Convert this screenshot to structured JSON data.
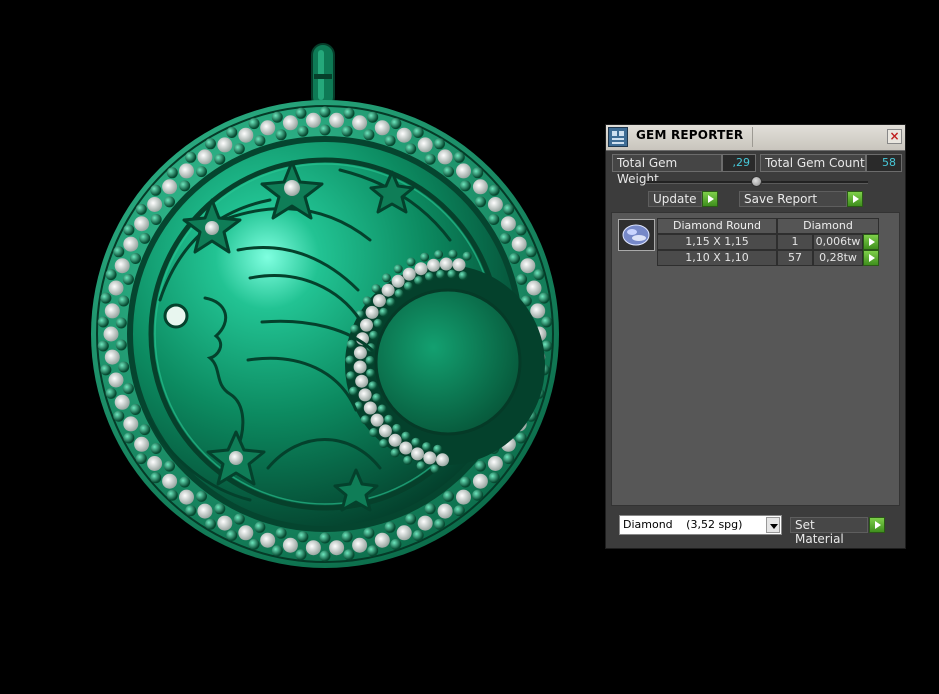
{
  "panel": {
    "title": "GEM REPORTER",
    "close_label": "×",
    "total_weight_label": "Total Gem Weight",
    "total_weight_value": ",29",
    "total_count_label": "Total Gem Count",
    "total_count_value": "58",
    "update_label": "Update",
    "save_report_label": "Save Report",
    "report": {
      "gem_icon": "gem-round-icon",
      "headers": [
        "Diamond Round",
        "Diamond"
      ],
      "rows": [
        {
          "size": "1,15 X 1,15",
          "count": "1",
          "weight": "0,006tw"
        },
        {
          "size": "1,10 X 1,10",
          "count": "57",
          "weight": "0,28tw"
        }
      ]
    },
    "material_select": {
      "name": "Diamond",
      "density": "(3,52 spg)"
    },
    "set_material_label": "Set Material"
  },
  "colors": {
    "panel_bg": "#3c3c3c",
    "value_text": "#47c8d8",
    "button_green": "#5fb234",
    "pendant_green": "#1f8f66"
  }
}
